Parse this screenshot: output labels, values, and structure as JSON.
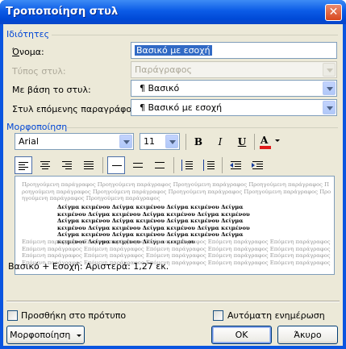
{
  "title": "Τροποποίηση στυλ",
  "close_symbol": "✕",
  "properties": {
    "heading": "Ιδιότητες",
    "name_label": "Όνομα:",
    "name_value": "Βασικό με εσοχή",
    "type_label": "Τύπος στυλ:",
    "type_value": "Παράγραφος",
    "based_label": "Με βάση το στυλ:",
    "based_value": "¶ Βασικό",
    "next_label": "Στυλ επόμενης παραγράφου:",
    "next_value": "¶ Βασικό με εσοχή"
  },
  "formatting": {
    "heading": "Μορφοποίηση",
    "font": "Arial",
    "size": "11",
    "bold": "B",
    "italic": "I",
    "underline": "U",
    "color_letter": "A",
    "color_bar": "#e01a1a"
  },
  "preview": {
    "before_text": "Προηγούμενη παράγραφος Προηγούμενη παράγραφος Προηγούμενη παράγραφος Προηγούμενη παράγραφος Προηγούμενη παράγραφος Προηγούμενη παράγραφος Προηγούμενη παράγραφος Προηγούμενη παράγραφος Προηγούμενη παράγραφος Προηγούμενη παράγραφος",
    "sample_text": "Δείγμα κειμένου Δείγμα κειμένου Δείγμα κειμένου Δείγμα κειμένου Δείγμα κειμένου Δείγμα κειμένου Δείγμα κειμένου Δείγμα κειμένου Δείγμα κειμένου Δείγμα κειμένου Δείγμα κειμένου Δείγμα κειμένου Δείγμα κειμένου Δείγμα κειμένου Δείγμα κειμένου Δείγμα κειμένου Δείγμα κειμένου Δείγμα κειμένου Δείγμα κειμένου Δείγμα κειμένου",
    "after_text": "Επόμενη παράγραφος Επόμενη παράγραφος Επόμενη παράγραφος Επόμενη παράγραφος Επόμενη παράγραφος Επόμενη παράγραφος Επόμενη παράγραφος Επόμενη παράγραφος Επόμενη παράγραφος Επόμενη παράγραφος Επόμενη παράγραφος Επόμενη παράγραφος Επόμενη παράγραφος Επόμενη παράγραφος Επόμενη παράγραφος Επόμενη παράγραφος Επόμενη παράγραφος Επόμενη παράγραφος Επόμενη παράγραφος Επόμενη παράγραφος"
  },
  "description": "Βασικό + Εσοχή: Αριστερά:  1,27 εκ.",
  "add_template_label": "Προσθήκη στο πρότυπο",
  "auto_update_label": "Αυτόματη ενημέρωση",
  "format_button": "Μορφοποίηση",
  "ok_button": "OK",
  "cancel_button": "Άκυρο"
}
